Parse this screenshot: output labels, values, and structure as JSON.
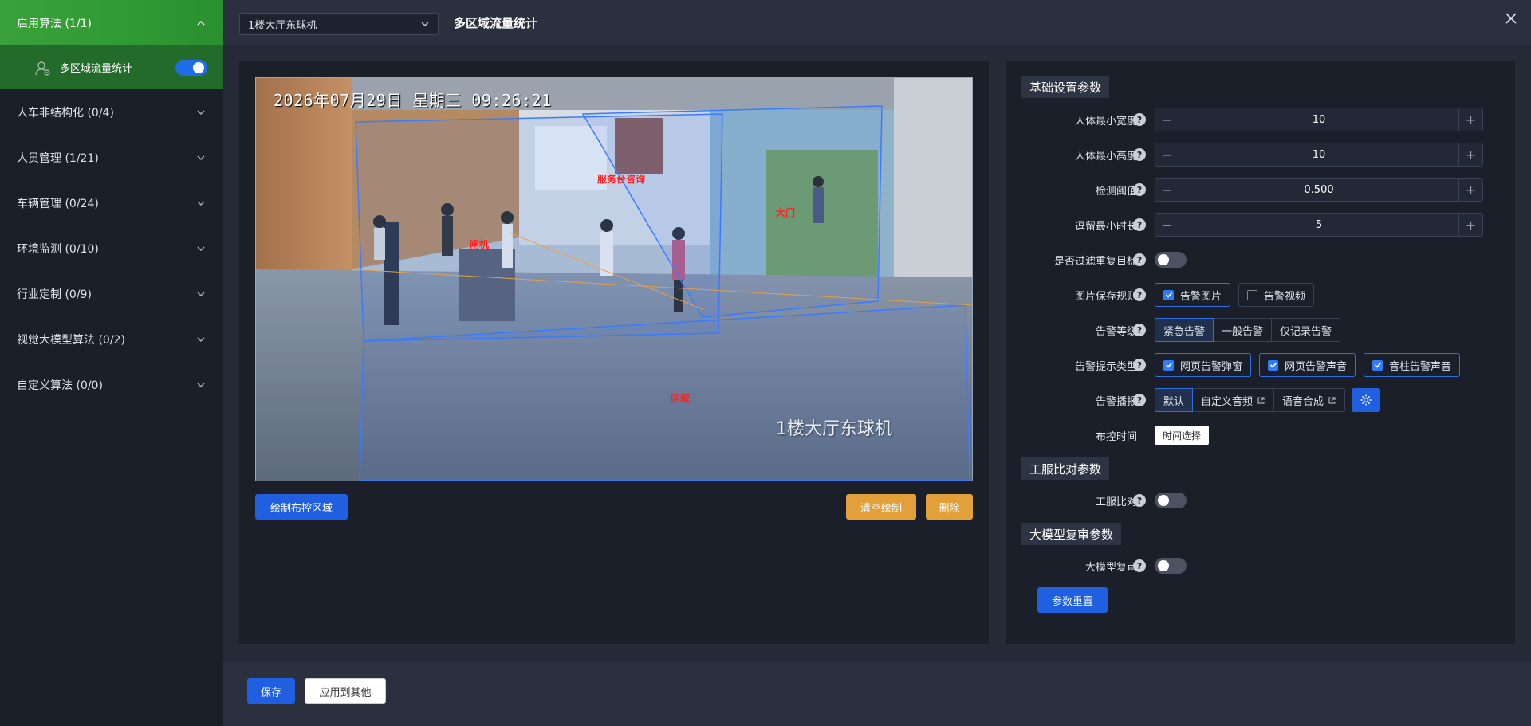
{
  "sidebar": {
    "categories": [
      {
        "label": "启用算法 (1/1)",
        "expanded": true
      },
      {
        "label": "人车非结构化 (0/4)"
      },
      {
        "label": "人员管理 (1/21)"
      },
      {
        "label": "车辆管理 (0/24)"
      },
      {
        "label": "环境监测 (0/10)"
      },
      {
        "label": "行业定制 (0/9)"
      },
      {
        "label": "视觉大模型算法 (0/2)"
      },
      {
        "label": "自定义算法 (0/0)"
      }
    ],
    "active_algorithm": {
      "label": "多区域流量统计",
      "enabled": true
    }
  },
  "topbar": {
    "camera_select": "1楼大厅东球机",
    "title": "多区域流量统计",
    "close_icon": "close-icon"
  },
  "video": {
    "osd_timestamp": "2026年07月29日  星期三  09:26:21",
    "camera_label": "1楼大厅东球机",
    "zones": [
      "服务台咨询",
      "大门",
      "闸机",
      "区域"
    ]
  },
  "video_actions": {
    "draw_label": "绘制布控区域",
    "clear_label": "清空绘制",
    "delete_label": "删除"
  },
  "settings": {
    "basic": {
      "title": "基础设置参数",
      "min_width": {
        "label": "人体最小宽度",
        "value": "10"
      },
      "min_height": {
        "label": "人体最小高度",
        "value": "10"
      },
      "threshold": {
        "label": "检测阈值",
        "value": "0.500"
      },
      "linger": {
        "label": "逗留最小时长",
        "value": "5"
      },
      "filter_dup": {
        "label": "是否过滤重复目标",
        "enabled": false
      },
      "image_rule": {
        "label": "图片保存规则",
        "options": [
          {
            "label": "告警图片",
            "checked": true
          },
          {
            "label": "告警视频",
            "checked": false
          }
        ]
      },
      "level": {
        "label": "告警等级",
        "options": [
          "紧急告警",
          "一般告警",
          "仅记录告警"
        ],
        "selected": "紧急告警"
      },
      "prompt_type": {
        "label": "告警提示类型",
        "options": [
          {
            "label": "网页告警弹窗",
            "checked": true
          },
          {
            "label": "网页告警声音",
            "checked": true
          },
          {
            "label": "音柱告警声音",
            "checked": true
          }
        ]
      },
      "broadcast": {
        "label": "告警播报",
        "options": [
          "默认",
          "自定义音频",
          "语音合成"
        ],
        "selected": "默认"
      },
      "schedule": {
        "label": "布控时间",
        "button": "时间选择"
      }
    },
    "uniform": {
      "title": "工服比对参数",
      "compare": {
        "label": "工服比对",
        "enabled": false
      }
    },
    "llm": {
      "title": "大模型复审参数",
      "review": {
        "label": "大模型复审",
        "enabled": false
      }
    },
    "reset_label": "参数重置"
  },
  "footer": {
    "save_label": "保存",
    "apply_label": "应用到其他"
  },
  "colors": {
    "accent_blue": "#1f5fe0",
    "active_green": "#3aa13a",
    "warn_orange": "#e2a03a"
  }
}
